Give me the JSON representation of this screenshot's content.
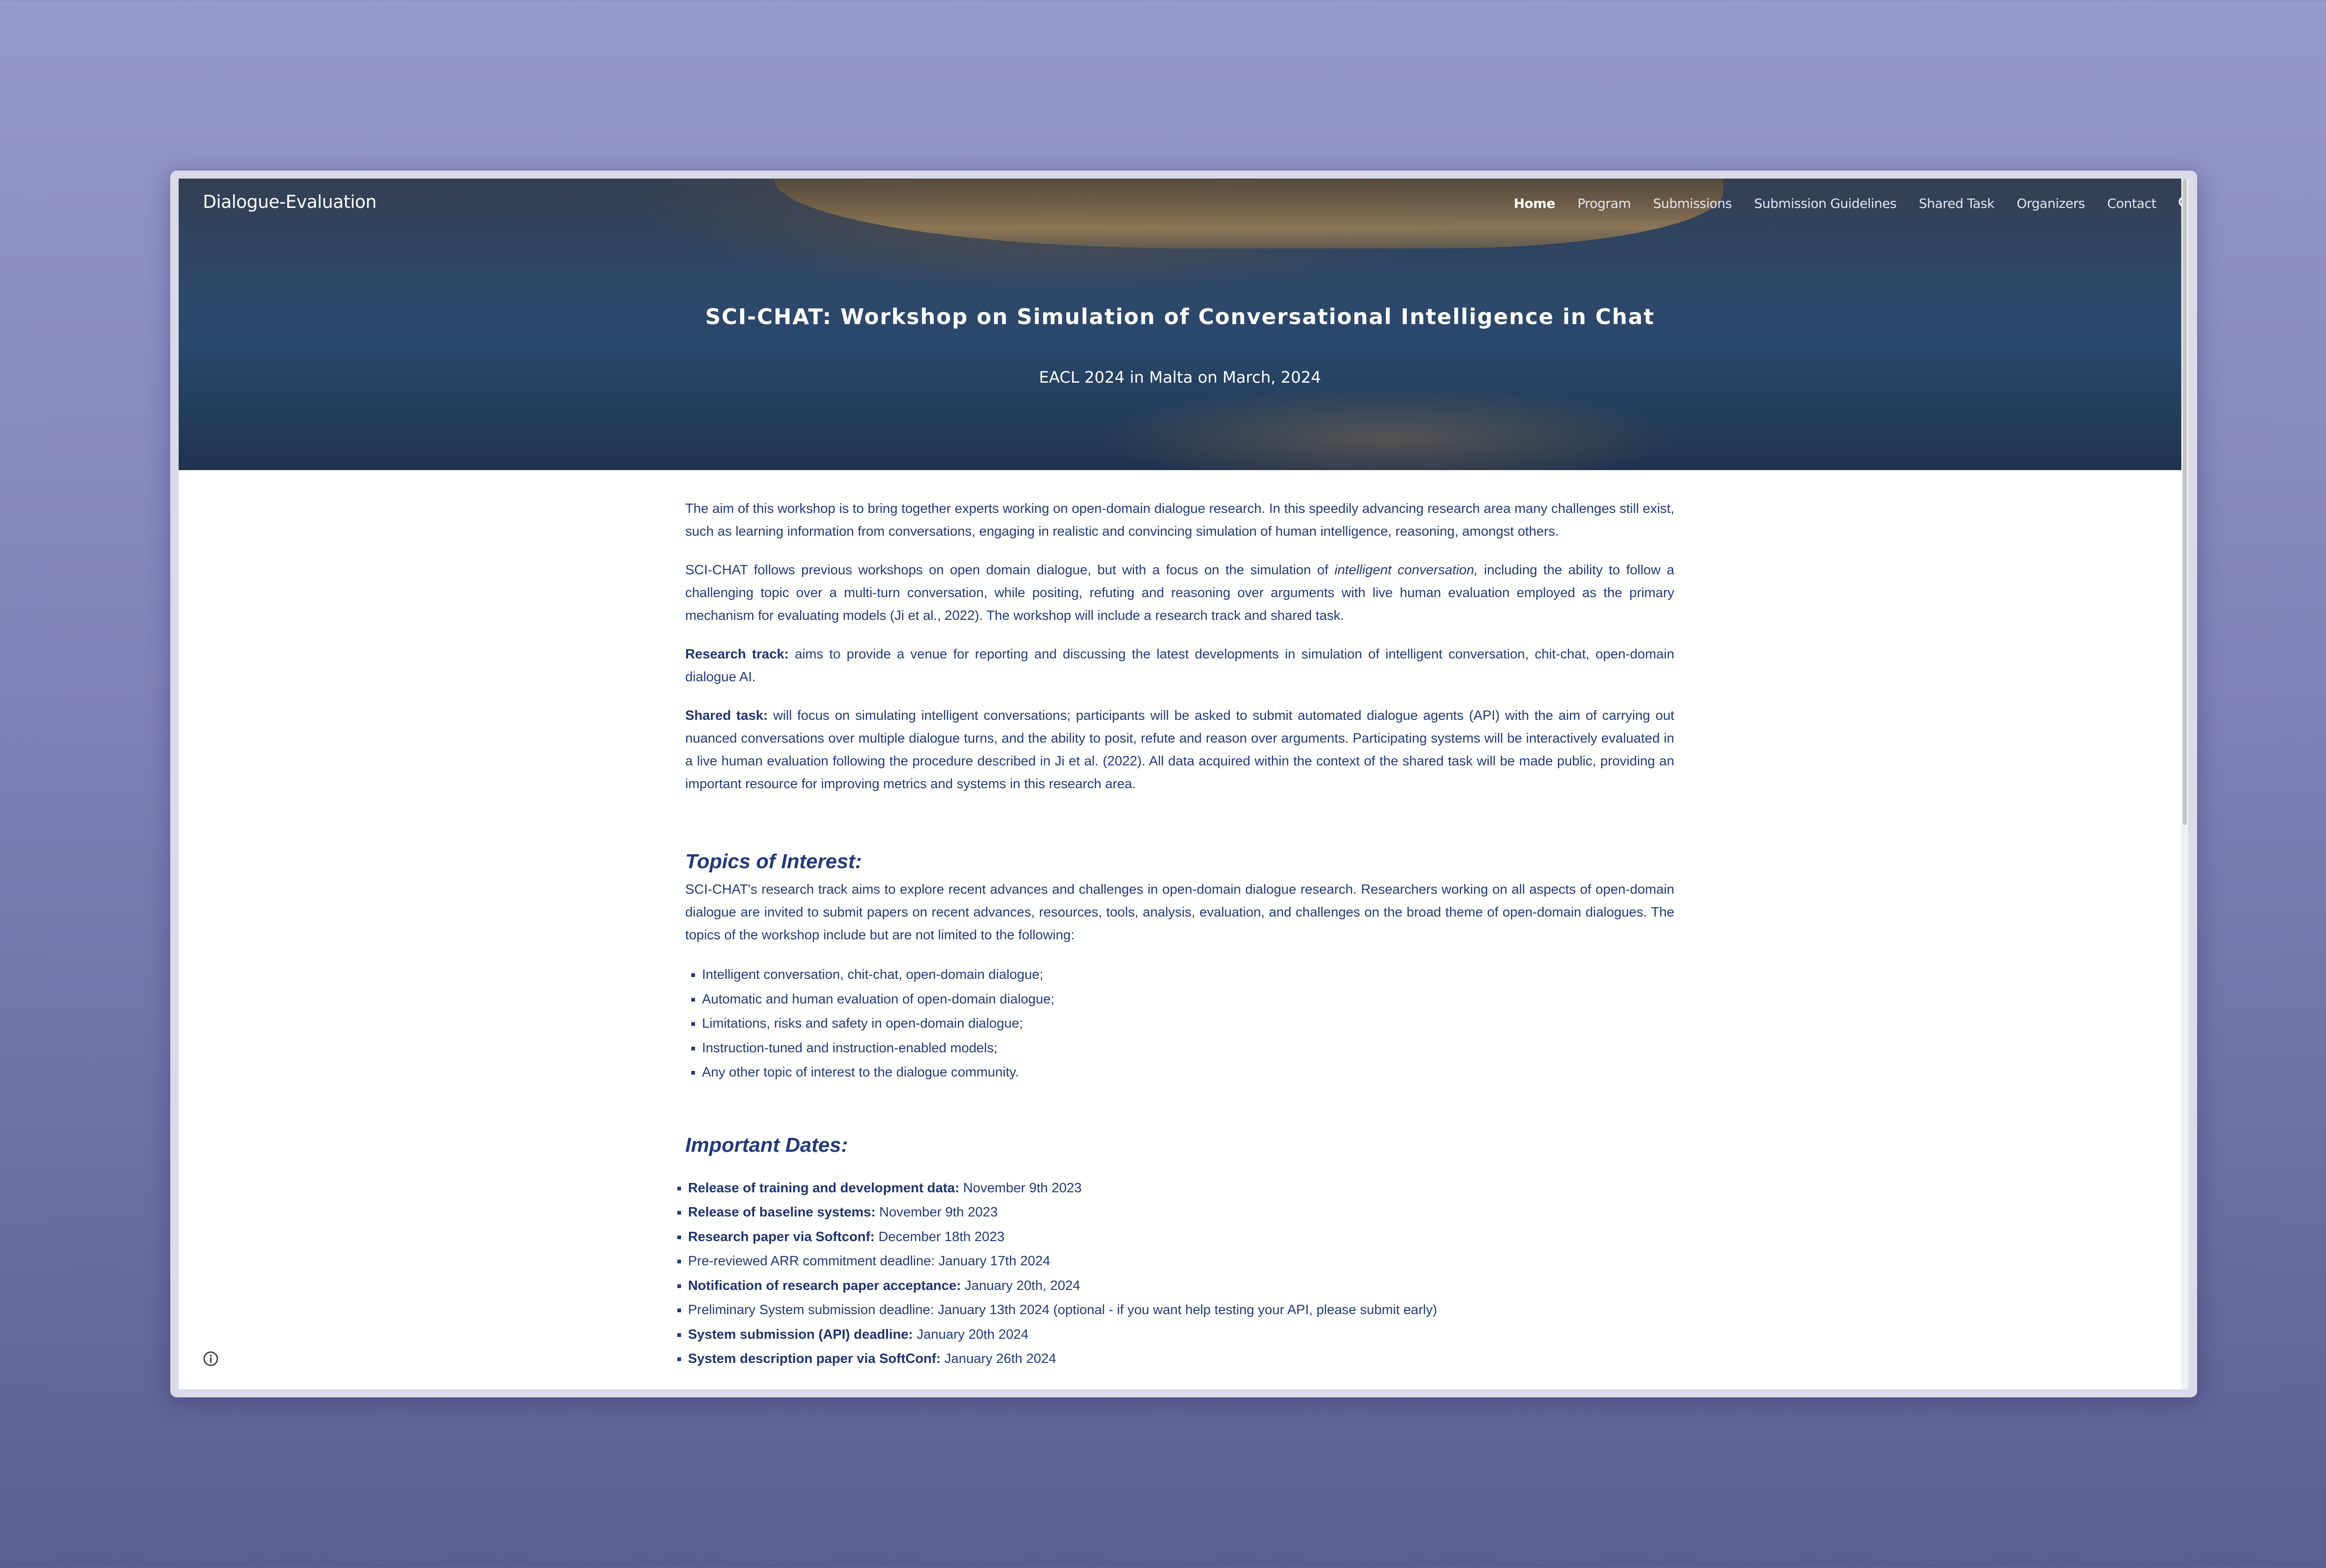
{
  "site": {
    "title": "Dialogue-Evaluation"
  },
  "nav": {
    "items": [
      {
        "label": "Home",
        "active": true
      },
      {
        "label": "Program"
      },
      {
        "label": "Submissions"
      },
      {
        "label": "Submission Guidelines"
      },
      {
        "label": "Shared Task"
      },
      {
        "label": "Organizers"
      },
      {
        "label": "Contact"
      }
    ],
    "search_icon": "search-icon"
  },
  "hero": {
    "title": "SCI-CHAT: Workshop on Simulation of Conversational Intelligence in Chat",
    "subtitle": "EACL 2024 in Malta on March, 2024"
  },
  "intro": {
    "p1": "The aim of this workshop is to bring together experts working on open-domain dialogue research. In this speedily advancing research area many challenges still exist, such as learning information from conversations, engaging in realistic and convincing simulation of human intelligence, reasoning, amongst others.",
    "p2_before": "SCI-CHAT follows previous workshops on open domain dialogue, but with a focus on the simulation of ",
    "p2_italic": "intelligent conversation,",
    "p2_after": " including the ability to follow a challenging topic over a multi-turn conversation, while positing, refuting and reasoning over arguments with live human evaluation employed as the primary mechanism for evaluating models (Ji et al., 2022). The workshop will include a research track and shared task.",
    "research_label": "Research track:",
    "research_text": " aims to provide a venue for reporting and discussing the latest developments in simulation of intelligent conversation, chit-chat, open-domain dialogue AI.",
    "shared_label": "Shared task:",
    "shared_text": " will focus on simulating intelligent conversations; participants will be asked to submit automated dialogue agents (API) with the aim of carrying out nuanced conversations over multiple dialogue turns, and the ability to posit, refute and reason over arguments. Participating systems will be interactively evaluated in a live human evaluation following the procedure described in Ji et al. (2022). All data acquired within the context of the shared task will be made public, providing an important resource for improving metrics and systems in this research area."
  },
  "topics": {
    "heading": "Topics of Interest:",
    "intro": "SCI-CHAT's research track aims to explore recent advances and challenges in open-domain dialogue research. Researchers working on all aspects of open-domain dialogue are invited to submit papers on recent advances, resources, tools, analysis, evaluation, and challenges on the broad theme of open-domain dialogues. The topics of the workshop include but are not limited to the following:",
    "items": [
      "Intelligent conversation, chit-chat, open-domain dialogue;",
      "Automatic and human evaluation of open-domain dialogue;",
      "Limitations, risks and safety in open-domain dialogue;",
      "Instruction-tuned and instruction-enabled models;",
      "Any other topic of interest to the dialogue community."
    ]
  },
  "dates": {
    "heading": "Important Dates:",
    "items": [
      {
        "label": "Release of training and development data:",
        "value": " November 9th 2023"
      },
      {
        "label": "Release of baseline systems:",
        "value": " November 9th 2023"
      },
      {
        "label": "Research paper via Softconf:",
        "value": " December 18th 2023"
      },
      {
        "label": "",
        "value": "Pre-reviewed ARR commitment deadline: January 17th 2024"
      },
      {
        "label": "Notification of research paper acceptance:",
        "value": " January 20th, 2024"
      },
      {
        "label": "",
        "value": "Preliminary System submission deadline: January 13th 2024 (optional - if you want help testing your API, please submit early)"
      },
      {
        "label": "System submission (API) deadline:",
        "value": " January 20th 2024"
      },
      {
        "label": "System description paper via SoftConf:",
        "value": " January 26th 2024"
      }
    ]
  },
  "footer": {
    "info_icon": "info-icon"
  }
}
